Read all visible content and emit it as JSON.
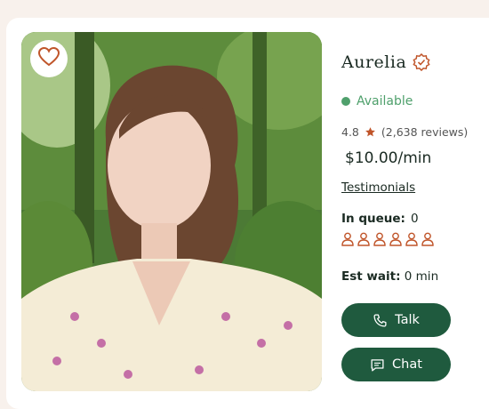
{
  "profile": {
    "name": "Aurelia",
    "status": "Available",
    "rating": "4.8",
    "reviews": "(2,638 reviews)",
    "price": "$10.00/min",
    "testimonials_link": "Testimonials",
    "queue_label": "In queue:",
    "queue_count": "0",
    "wait_label": "Est wait:",
    "wait_value": "0 min"
  },
  "actions": {
    "talk_label": "Talk",
    "chat_label": "Chat"
  },
  "colors": {
    "accent": "#c0552a",
    "status": "#4fa06c",
    "button": "#1f5a3e"
  },
  "icons": [
    "heart-icon",
    "verified-badge-icon",
    "star-icon",
    "person-icon",
    "phone-icon",
    "chat-bubble-icon"
  ]
}
